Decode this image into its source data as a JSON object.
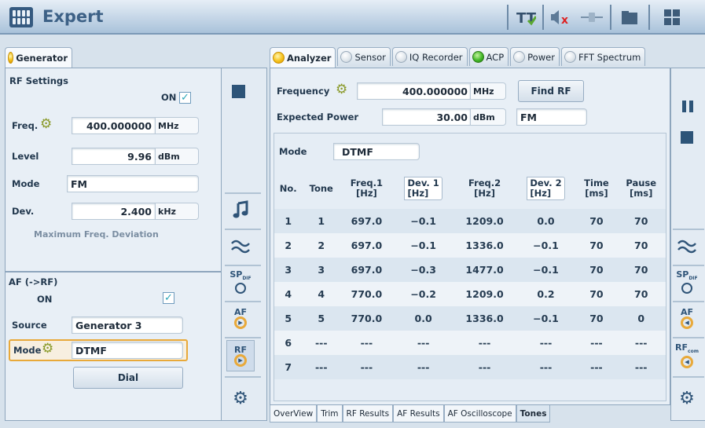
{
  "app": {
    "title": "Expert"
  },
  "generator": {
    "tab_label": "Generator",
    "rf_settings_label": "RF Settings",
    "on_label": "ON",
    "freq": {
      "label": "Freq.",
      "value": "400.000000",
      "unit": "MHz"
    },
    "level": {
      "label": "Level",
      "value": "9.96",
      "unit": "dBm"
    },
    "mode": {
      "label": "Mode",
      "value": "FM"
    },
    "dev": {
      "label": "Dev.",
      "value": "2.400",
      "unit": "kHz"
    },
    "max_dev_label": "Maximum Freq. Deviation",
    "af_label": "AF (->RF)",
    "af_on_label": "ON",
    "source": {
      "label": "Source",
      "value": "Generator 3"
    },
    "af_mode": {
      "label": "Mode",
      "value": "DTMF"
    },
    "dial_label": "Dial"
  },
  "analyzer_tabs": [
    {
      "label": "Analyzer",
      "state": "on"
    },
    {
      "label": "Sensor",
      "state": "off"
    },
    {
      "label": "IQ Recorder",
      "state": "off"
    },
    {
      "label": "ACP",
      "state": "green"
    },
    {
      "label": "Power",
      "state": "off"
    },
    {
      "label": "FFT Spectrum",
      "state": "off"
    }
  ],
  "analyzer": {
    "frequency": {
      "label": "Frequency",
      "value": "400.000000",
      "unit": "MHz"
    },
    "find_rf_label": "Find RF",
    "expected_power": {
      "label": "Expected Power",
      "value": "30.00",
      "unit": "dBm"
    },
    "demod": "FM",
    "mode": {
      "label": "Mode",
      "value": "DTMF"
    }
  },
  "tones_table": {
    "headers": [
      "No.",
      "Tone",
      "Freq.1\n[Hz]",
      "Dev. 1\n[Hz]",
      "Freq.2\n[Hz]",
      "Dev. 2\n[Hz]",
      "Time\n[ms]",
      "Pause\n[ms]"
    ],
    "rows": [
      [
        "1",
        "1",
        "697.0",
        "−0.1",
        "1209.0",
        "0.0",
        "70",
        "70"
      ],
      [
        "2",
        "2",
        "697.0",
        "−0.1",
        "1336.0",
        "−0.1",
        "70",
        "70"
      ],
      [
        "3",
        "3",
        "697.0",
        "−0.3",
        "1477.0",
        "−0.1",
        "70",
        "70"
      ],
      [
        "4",
        "4",
        "770.0",
        "−0.2",
        "1209.0",
        "0.2",
        "70",
        "70"
      ],
      [
        "5",
        "5",
        "770.0",
        "0.0",
        "1336.0",
        "−0.1",
        "70",
        "0"
      ],
      [
        "6",
        "---",
        "---",
        "---",
        "---",
        "---",
        "---",
        "---"
      ],
      [
        "7",
        "---",
        "---",
        "---",
        "---",
        "---",
        "---",
        "---"
      ]
    ]
  },
  "bottom_tabs": [
    "OverView",
    "Trim",
    "RF Results",
    "AF Results",
    "AF Oscilloscope",
    "Tones"
  ],
  "bottom_active": "Tones",
  "side_icons": {
    "sp_label": "SP",
    "sp_sub": "DIF",
    "af_label": "AF",
    "rf_label": "RF",
    "rf_sub": "com"
  },
  "colors": {
    "title": "#3d6186",
    "accent_orange": "#e8a93a",
    "check": "#2aa5b7"
  }
}
